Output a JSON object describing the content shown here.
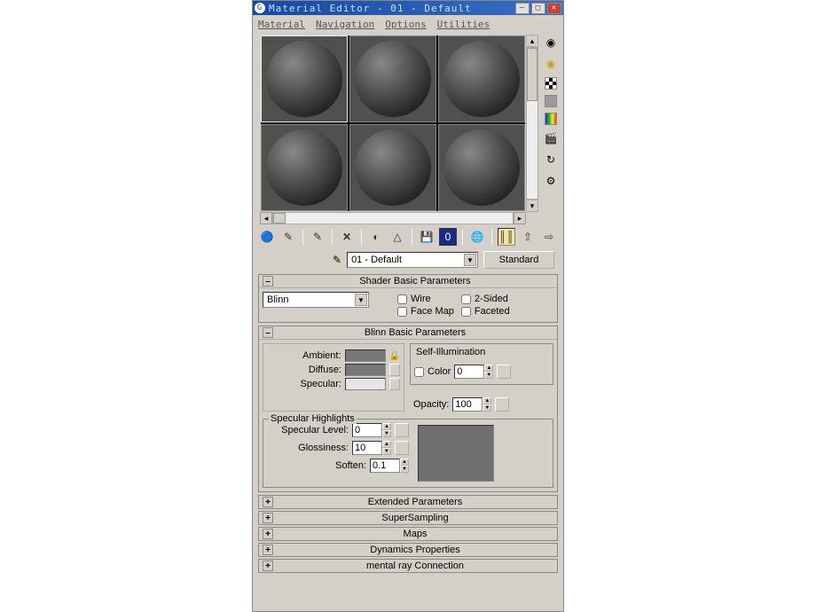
{
  "title": "Material Editor - 01 - Default",
  "menus": [
    "Material",
    "Navigation",
    "Options",
    "Utilities"
  ],
  "material_selector": {
    "value": "01 - Default",
    "type_button": "Standard"
  },
  "rollouts": {
    "shader_basic": {
      "title": "Shader Basic Parameters",
      "shader_type": "Blinn",
      "wire": "Wire",
      "two_sided": "2-Sided",
      "face_map": "Face Map",
      "faceted": "Faceted"
    },
    "blinn_basic": {
      "title": "Blinn Basic Parameters",
      "ambient_label": "Ambient:",
      "diffuse_label": "Diffuse:",
      "specular_label": "Specular:",
      "self_illum": {
        "legend": "Self-Illumination",
        "color_label": "Color",
        "value": "0"
      },
      "opacity_label": "Opacity:",
      "opacity_value": "100",
      "spec_highlights": {
        "legend": "Specular Highlights",
        "specular_level_label": "Specular Level:",
        "specular_level": "0",
        "glossiness_label": "Glossiness:",
        "glossiness": "10",
        "soften_label": "Soften:",
        "soften": "0.1"
      }
    },
    "collapsed": [
      "Extended Parameters",
      "SuperSampling",
      "Maps",
      "Dynamics Properties",
      "mental ray Connection"
    ]
  },
  "side_icons": [
    "sphere-dark-icon",
    "sphere-lit-icon",
    "checker-icon",
    "gray-swatch-icon",
    "rainbow-icon",
    "camera-icon",
    "refresh-icon",
    "options-icon"
  ],
  "h_toolbar_icons": [
    "get-material-icon",
    "put-scene-icon",
    "assign-icon",
    "delete-icon",
    "reset-icon",
    "effects-icon",
    "show-map-icon",
    "end-result-icon",
    "nav-icon",
    "select-by-material-icon",
    "pick-sample-icon",
    "pick-global-icon"
  ]
}
